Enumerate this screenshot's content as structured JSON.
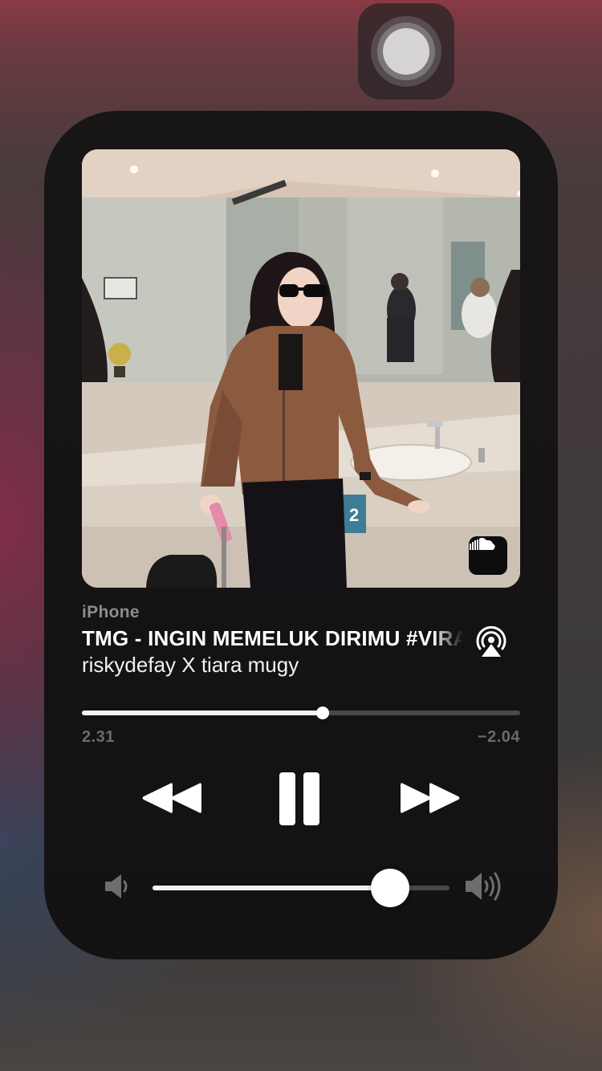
{
  "assistive_touch": {
    "icon": "assistive-touch-icon"
  },
  "player": {
    "device": "iPhone",
    "title": "TMG - INGIN MEMELUK DIRIMU #VIRAL",
    "artist": "riskydefay X tiara mugy",
    "artwork_badge": "soundcloud-icon",
    "progress": 0.55,
    "elapsed": "2.31",
    "remaining": "−2.04",
    "volume": 0.8,
    "state": "playing"
  },
  "controls": {
    "rewind": "rewind-icon",
    "pause": "pause-icon",
    "fast_forward": "fast-forward-icon",
    "airplay": "airplay-audio-icon",
    "volume_low": "speaker-low-icon",
    "volume_high": "speaker-high-icon"
  },
  "colors": {
    "card": "#141213",
    "primary_text": "#ffffff",
    "secondary_text": "#8d8b8c",
    "track": "#4a4849",
    "fill": "#f4f2f3"
  }
}
